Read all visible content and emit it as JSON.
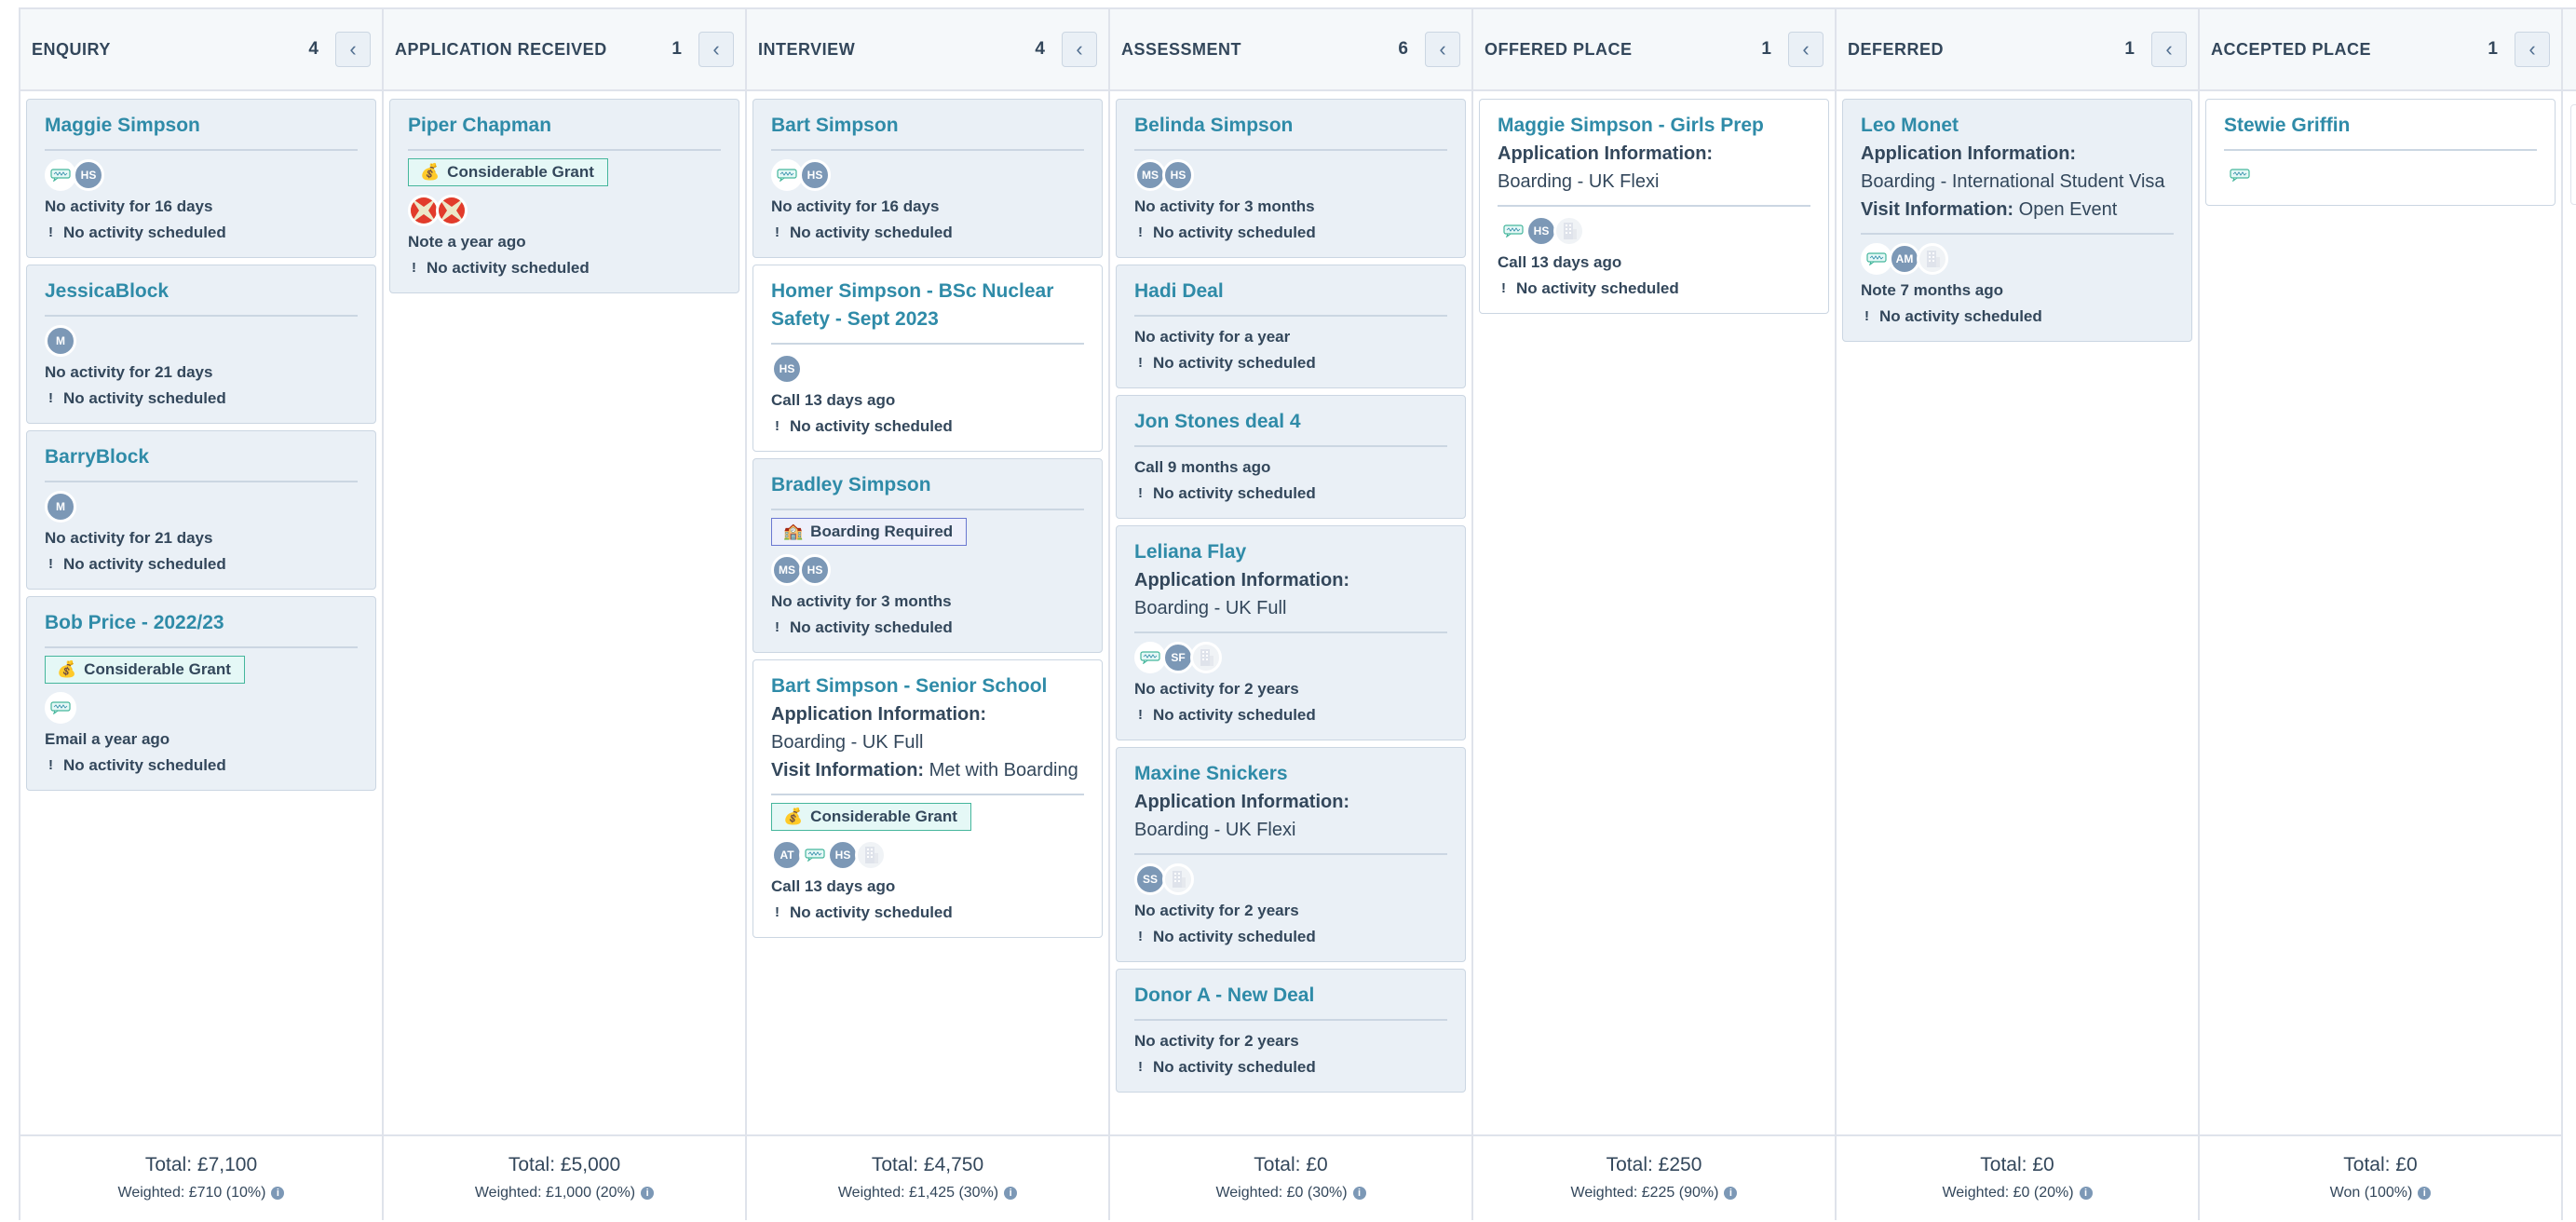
{
  "colors": {
    "card_title": "#2f8ba8",
    "card_bg": "#eaf0f6",
    "header_bg": "#f5f8fa",
    "text": "#33475b",
    "avatar": "#7c98b6",
    "grant_tag_border": "#45b69c",
    "boarding_tag_border": "#6a78d1"
  },
  "common": {
    "no_activity_scheduled": "No activity scheduled",
    "collapse_glyph": "‹",
    "info_glyph": "i"
  },
  "columns": [
    {
      "title": "ENQUIRY",
      "count": "4",
      "total": "Total: £7,100",
      "weighted": "Weighted: £710 (10%)",
      "cards": [
        {
          "title": "Maggie Simpson",
          "avatars": [
            "chat",
            "HS"
          ],
          "activity": "No activity for 16 days"
        },
        {
          "title": "JessicaBlock",
          "avatars": [
            "M"
          ],
          "activity": "No activity for 21 days"
        },
        {
          "title": "BarryBlock",
          "avatars": [
            "M"
          ],
          "activity": "No activity for 21 days"
        },
        {
          "title": "Bob Price - 2022/23",
          "tag": {
            "type": "grant",
            "emoji": "💰",
            "label": "Considerable Grant"
          },
          "avatars": [
            "chat"
          ],
          "activity": "Email a year ago"
        }
      ]
    },
    {
      "title": "APPLICATION RECEIVED",
      "count": "1",
      "total": "Total: £5,000",
      "weighted": "Weighted: £1,000 (20%)",
      "cards": [
        {
          "title": "Piper Chapman",
          "tag": {
            "type": "grant",
            "emoji": "💰",
            "label": "Considerable Grant"
          },
          "avatars": [
            "xflag",
            "xflag"
          ],
          "activity": "Note a year ago"
        }
      ]
    },
    {
      "title": "INTERVIEW",
      "count": "4",
      "total": "Total: £4,750",
      "weighted": "Weighted: £1,425 (30%)",
      "cards": [
        {
          "title": "Bart Simpson",
          "avatars": [
            "chat",
            "HS"
          ],
          "activity": "No activity for 16 days"
        },
        {
          "title": "Homer Simpson - BSc Nuclear Safety - Sept 2023",
          "white": true,
          "avatars": [
            "HS"
          ],
          "activity": "Call 13 days ago"
        },
        {
          "title": "Bradley Simpson",
          "tag": {
            "type": "boarding",
            "emoji": "🏫",
            "label": "Boarding Required"
          },
          "avatars": [
            "MS",
            "HS"
          ],
          "activity": "No activity for 3 months"
        },
        {
          "title": "Bart Simpson - Senior School",
          "white": true,
          "app_info": {
            "label": "Application Information:",
            "value": "Boarding - UK Full"
          },
          "visit_info": {
            "label": "Visit Information:",
            "value": "Met with Boarding"
          },
          "tag": {
            "type": "grant",
            "emoji": "💰",
            "label": "Considerable Grant"
          },
          "avatars": [
            "AT",
            "chat",
            "HS",
            "building"
          ],
          "activity": "Call 13 days ago"
        }
      ]
    },
    {
      "title": "ASSESSMENT",
      "count": "6",
      "total": "Total: £0",
      "weighted": "Weighted: £0 (30%)",
      "cards": [
        {
          "title": "Belinda Simpson",
          "avatars": [
            "MS",
            "HS"
          ],
          "activity": "No activity for 3 months"
        },
        {
          "title": "Hadi Deal",
          "avatars": [],
          "activity": "No activity for a year"
        },
        {
          "title": "Jon Stones deal 4",
          "avatars": [],
          "activity": "Call 9 months ago"
        },
        {
          "title": "Leliana Flay",
          "app_info": {
            "label": "Application Information:",
            "value": "Boarding - UK Full"
          },
          "avatars": [
            "chat",
            "SF",
            "building"
          ],
          "activity": "No activity for 2 years"
        },
        {
          "title": "Maxine Snickers",
          "app_info": {
            "label": "Application Information:",
            "value": "Boarding - UK Flexi"
          },
          "avatars": [
            "SS",
            "building"
          ],
          "activity": "No activity for 2 years"
        },
        {
          "title": "Donor A - New Deal",
          "avatars": [],
          "activity": "No activity for 2 years"
        }
      ]
    },
    {
      "title": "OFFERED PLACE",
      "count": "1",
      "total": "Total: £250",
      "weighted": "Weighted: £225 (90%)",
      "cards": [
        {
          "title": "Maggie Simpson - Girls Prep",
          "white": true,
          "app_info": {
            "label": "Application Information:",
            "value": "Boarding - UK Flexi"
          },
          "avatars": [
            "chat-bare",
            "HS",
            "building"
          ],
          "activity": "Call 13 days ago"
        }
      ]
    },
    {
      "title": "DEFERRED",
      "count": "1",
      "total": "Total: £0",
      "weighted": "Weighted: £0 (20%)",
      "cards": [
        {
          "title": "Leo Monet",
          "app_info": {
            "label": "Application Information:",
            "value": "Boarding - International Student Visa"
          },
          "visit_info": {
            "label": "Visit Information:",
            "value": "Open Event"
          },
          "avatars": [
            "chat",
            "AM",
            "building"
          ],
          "activity": "Note 7 months ago"
        }
      ]
    },
    {
      "title": "ACCEPTED PLACE",
      "count": "1",
      "total": "Total: £0",
      "weighted": "Won (100%)",
      "cards": [
        {
          "title": "Stewie Griffin",
          "white": true,
          "avatars": [
            "chat-bare"
          ],
          "no_activity_lines": true
        }
      ]
    }
  ]
}
